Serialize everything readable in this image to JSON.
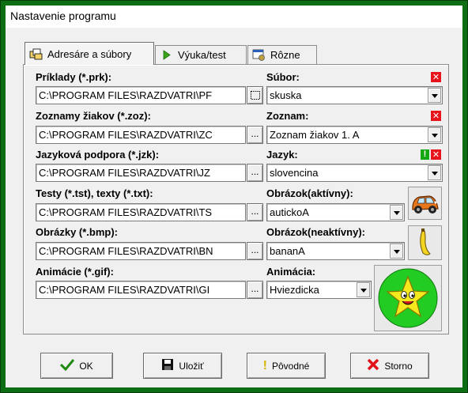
{
  "window": {
    "title": "Nastavenie programu"
  },
  "tabs": [
    {
      "label": "Adresáre a súbory",
      "icon": "folders-icon"
    },
    {
      "label": "Výuka/test",
      "icon": "play-triangle-icon"
    },
    {
      "label": "Rôzne",
      "icon": "window-gear-icon"
    }
  ],
  "fields": {
    "priklady": {
      "label": "Príklady (*.prk):",
      "value": "C:\\PROGRAM FILES\\RAZDVATRI\\PF"
    },
    "zoznamy": {
      "label": "Zoznamy žiakov (*.zoz):",
      "value": "C:\\PROGRAM FILES\\RAZDVATRI\\ZC",
      "browse": "..."
    },
    "jazykova": {
      "label": "Jazyková podpora (*.jzk):",
      "value": "C:\\PROGRAM FILES\\RAZDVATRI\\JZ",
      "browse": "..."
    },
    "testy": {
      "label": "Testy (*.tst), texty (*.txt):",
      "value": "C:\\PROGRAM FILES\\RAZDVATRI\\TS",
      "browse": "..."
    },
    "obrazky": {
      "label": "Obrázky (*.bmp):",
      "value": "C:\\PROGRAM FILES\\RAZDVATRI\\BN",
      "browse": "..."
    },
    "animacie": {
      "label": "Animácie (*.gif):",
      "value": "C:\\PROGRAM FILES\\RAZDVATRI\\GI",
      "browse": "..."
    }
  },
  "selects": {
    "subor": {
      "label": "Súbor:",
      "value": "skuska"
    },
    "zoznam": {
      "label": "Zoznam:",
      "value": "Zoznam žiakov 1. A"
    },
    "jazyk": {
      "label": "Jazyk:",
      "value": "slovencina"
    },
    "obrazok_aktivny": {
      "label": "Obrázok(aktívny):",
      "value": "autickoA"
    },
    "obrazok_neaktivny": {
      "label": "Obrázok(neaktívny):",
      "value": "bananA"
    },
    "animacia": {
      "label": "Animácia:",
      "value": "Hviezdicka"
    }
  },
  "buttons": {
    "ok": "OK",
    "ulozit": "Uložiť",
    "povodne": "Pôvodné",
    "storno": "Storno"
  },
  "colors": {
    "window_frame": "#0d6d12",
    "delete_icon": "#e8141c",
    "add_icon": "#13a80f",
    "star_bg": "#22cc22",
    "star": "#f5e81c"
  }
}
